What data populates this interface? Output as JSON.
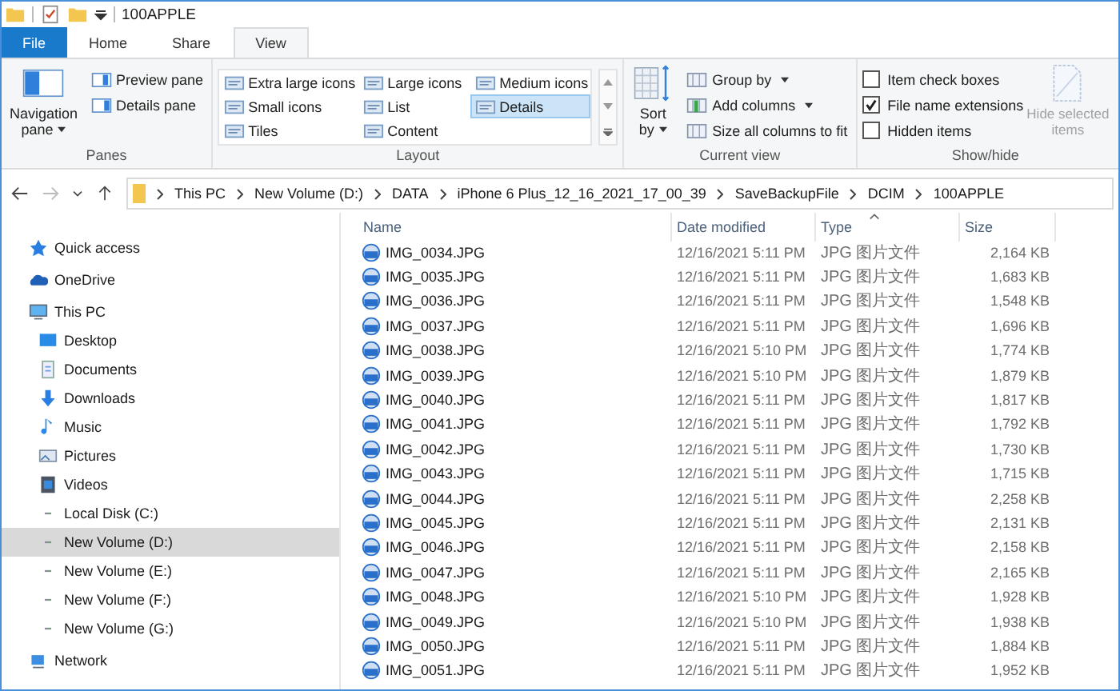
{
  "window": {
    "title": "100APPLE"
  },
  "tabs": [
    {
      "label": "File",
      "selected": false,
      "kind": "file"
    },
    {
      "label": "Home",
      "selected": false,
      "kind": "tab"
    },
    {
      "label": "Share",
      "selected": false,
      "kind": "tab"
    },
    {
      "label": "View",
      "selected": true,
      "kind": "tab"
    }
  ],
  "ribbon": {
    "panes": {
      "label": "Panes",
      "navigation_pane": [
        "Navigation",
        "pane"
      ],
      "items": [
        "Preview pane",
        "Details pane"
      ]
    },
    "layout": {
      "label": "Layout",
      "options": [
        {
          "label": "Extra large icons",
          "selected": false
        },
        {
          "label": "Large icons",
          "selected": false
        },
        {
          "label": "Medium icons",
          "selected": false
        },
        {
          "label": "Small icons",
          "selected": false
        },
        {
          "label": "List",
          "selected": false
        },
        {
          "label": "Details",
          "selected": true
        },
        {
          "label": "Tiles",
          "selected": false
        },
        {
          "label": "Content",
          "selected": false
        }
      ]
    },
    "current_view": {
      "label": "Current view",
      "sort_by": [
        "Sort",
        "by"
      ],
      "items": [
        "Group by",
        "Add columns",
        "Size all columns to fit"
      ]
    },
    "show_hide": {
      "label": "Show/hide",
      "checkboxes": [
        {
          "label": "Item check boxes",
          "checked": false
        },
        {
          "label": "File name extensions",
          "checked": true
        },
        {
          "label": "Hidden items",
          "checked": false
        }
      ],
      "hide_selected": {
        "label": [
          "Hide selected",
          "items"
        ],
        "disabled": true
      }
    }
  },
  "breadcrumb": [
    "This PC",
    "New Volume (D:)",
    "DATA",
    "iPhone 6 Plus_12_16_2021_17_00_39",
    "SaveBackupFile",
    "DCIM",
    "100APPLE"
  ],
  "sidebar": {
    "items": [
      {
        "label": "Quick access",
        "kind": "star",
        "selected": false
      },
      {
        "label": "OneDrive",
        "kind": "cloud",
        "selected": false
      },
      {
        "label": "This PC",
        "kind": "pc",
        "selected": false,
        "children": [
          {
            "label": "Desktop",
            "kind": "desktop",
            "selected": false
          },
          {
            "label": "Documents",
            "kind": "documents",
            "selected": false
          },
          {
            "label": "Downloads",
            "kind": "downloads",
            "selected": false
          },
          {
            "label": "Music",
            "kind": "music",
            "selected": false
          },
          {
            "label": "Pictures",
            "kind": "pictures",
            "selected": false
          },
          {
            "label": "Videos",
            "kind": "videos",
            "selected": false
          },
          {
            "label": "Local Disk (C:)",
            "kind": "drive",
            "selected": false
          },
          {
            "label": "New Volume (D:)",
            "kind": "drive",
            "selected": true
          },
          {
            "label": "New Volume (E:)",
            "kind": "drive",
            "selected": false
          },
          {
            "label": "New Volume (F:)",
            "kind": "drive",
            "selected": false
          },
          {
            "label": "New Volume (G:)",
            "kind": "drive",
            "selected": false
          }
        ]
      },
      {
        "label": "Network",
        "kind": "network",
        "selected": false
      }
    ]
  },
  "table": {
    "columns": [
      "Name",
      "Date modified",
      "Type",
      "Size"
    ],
    "rows": [
      [
        "IMG_0034.JPG",
        "12/16/2021 5:11 PM",
        "JPG 图片文件",
        "2,164 KB"
      ],
      [
        "IMG_0035.JPG",
        "12/16/2021 5:11 PM",
        "JPG 图片文件",
        "1,683 KB"
      ],
      [
        "IMG_0036.JPG",
        "12/16/2021 5:11 PM",
        "JPG 图片文件",
        "1,548 KB"
      ],
      [
        "IMG_0037.JPG",
        "12/16/2021 5:11 PM",
        "JPG 图片文件",
        "1,696 KB"
      ],
      [
        "IMG_0038.JPG",
        "12/16/2021 5:10 PM",
        "JPG 图片文件",
        "1,774 KB"
      ],
      [
        "IMG_0039.JPG",
        "12/16/2021 5:10 PM",
        "JPG 图片文件",
        "1,879 KB"
      ],
      [
        "IMG_0040.JPG",
        "12/16/2021 5:11 PM",
        "JPG 图片文件",
        "1,817 KB"
      ],
      [
        "IMG_0041.JPG",
        "12/16/2021 5:11 PM",
        "JPG 图片文件",
        "1,792 KB"
      ],
      [
        "IMG_0042.JPG",
        "12/16/2021 5:11 PM",
        "JPG 图片文件",
        "1,730 KB"
      ],
      [
        "IMG_0043.JPG",
        "12/16/2021 5:11 PM",
        "JPG 图片文件",
        "1,715 KB"
      ],
      [
        "IMG_0044.JPG",
        "12/16/2021 5:11 PM",
        "JPG 图片文件",
        "2,258 KB"
      ],
      [
        "IMG_0045.JPG",
        "12/16/2021 5:11 PM",
        "JPG 图片文件",
        "2,131 KB"
      ],
      [
        "IMG_0046.JPG",
        "12/16/2021 5:11 PM",
        "JPG 图片文件",
        "2,158 KB"
      ],
      [
        "IMG_0047.JPG",
        "12/16/2021 5:11 PM",
        "JPG 图片文件",
        "2,165 KB"
      ],
      [
        "IMG_0048.JPG",
        "12/16/2021 5:10 PM",
        "JPG 图片文件",
        "1,928 KB"
      ],
      [
        "IMG_0049.JPG",
        "12/16/2021 5:10 PM",
        "JPG 图片文件",
        "1,938 KB"
      ],
      [
        "IMG_0050.JPG",
        "12/16/2021 5:11 PM",
        "JPG 图片文件",
        "1,884 KB"
      ],
      [
        "IMG_0051.JPG",
        "12/16/2021 5:11 PM",
        "JPG 图片文件",
        "1,952 KB"
      ]
    ]
  }
}
